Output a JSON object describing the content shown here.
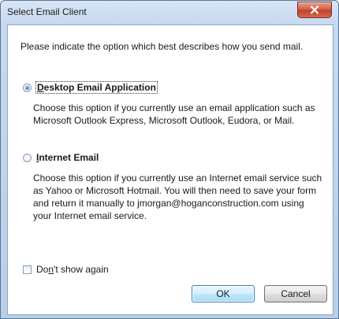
{
  "window": {
    "title": "Select Email Client",
    "close_glyph": "✕"
  },
  "intro": "Please indicate the option which best describes how you send mail.",
  "options": [
    {
      "label": "Desktop Email Application",
      "mnemonic": "D",
      "selected": true,
      "description": "Choose this option if you currently use an email application such as Microsoft Outlook Express, Microsoft Outlook, Eudora, or Mail."
    },
    {
      "label": "Internet Email",
      "mnemonic": "I",
      "selected": false,
      "description": "Choose this option if you currently use an Internet email service such as Yahoo or Microsoft Hotmail. You will then need to save your form and return it manually to jmorgan@hoganconstruction.com using your Internet email service."
    }
  ],
  "dont_show": {
    "label": "Don't show again",
    "checked": false
  },
  "buttons": {
    "ok": "OK",
    "cancel": "Cancel"
  },
  "colors": {
    "accent": "#2a6fc0",
    "close": "#c0412b"
  }
}
